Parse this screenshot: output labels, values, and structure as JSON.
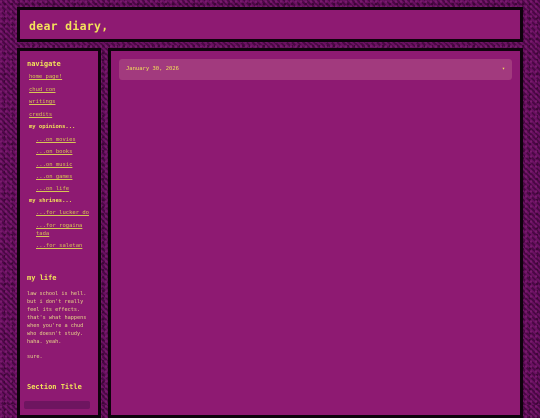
{
  "header": {
    "title": "dear diary,"
  },
  "sidebar": {
    "navigate_heading": "navigate",
    "links": [
      "home page!",
      "chud con",
      "writings",
      "credits"
    ],
    "opinions_heading": "my opinions...",
    "opinions": [
      "...on movies",
      "...on books",
      "...on music",
      "...on games",
      "...on life"
    ],
    "shrines_heading": "my shrines...",
    "shrines": [
      {
        "line1": "...for lucker do",
        "line2": ""
      },
      {
        "line1": "...for rogaina",
        "line2": "tada"
      },
      {
        "line1": "...for saletan",
        "line2": ""
      }
    ],
    "life_heading": "my life",
    "life_text": [
      "law school is hell.",
      "but i don't really",
      "feel its effects.",
      "that's what happens",
      "when you're a chud",
      "who doesn't study.",
      "haha. yeah."
    ],
    "life_sign": "sure.",
    "section_title": "Section Title"
  },
  "main": {
    "date": "January 30, 2026",
    "chevron": "▾"
  }
}
